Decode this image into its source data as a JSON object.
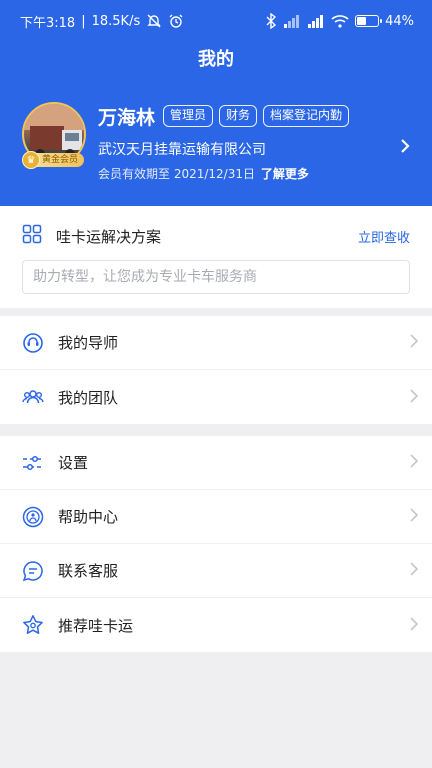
{
  "statusbar": {
    "time": "下午3:18",
    "speed": "18.5K/s",
    "battery": "44"
  },
  "header": {
    "title": "我的"
  },
  "profile": {
    "name": "万海林",
    "badge": "黄金会员",
    "tags": [
      "管理员",
      "财务",
      "档案登记内勤"
    ],
    "company": "武汉天月挂靠运输有限公司",
    "expiry_text": "会员有效期至 2021/12/31日",
    "expiry_more": "了解更多"
  },
  "solution": {
    "title": "哇卡运解决方案",
    "link": "立即查收",
    "placeholder": "助力转型，让您成为专业卡车服务商"
  },
  "menu_group_1": [
    {
      "label": "我的导师",
      "icon": "mentor-icon"
    },
    {
      "label": "我的团队",
      "icon": "team-icon"
    }
  ],
  "menu_group_2": [
    {
      "label": "设置",
      "icon": "settings-icon"
    },
    {
      "label": "帮助中心",
      "icon": "help-icon"
    },
    {
      "label": "联系客服",
      "icon": "chat-icon"
    },
    {
      "label": "推荐哇卡运",
      "icon": "star-icon"
    }
  ],
  "colors": {
    "primary": "#2a66e6",
    "gold": "#efc15a",
    "background": "#efeff1"
  }
}
